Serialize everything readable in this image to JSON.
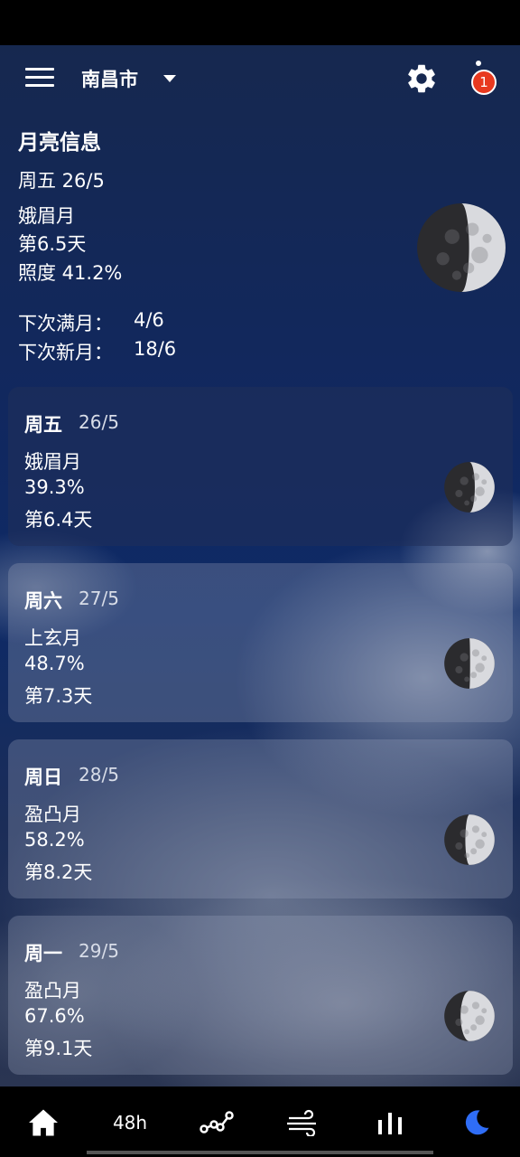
{
  "header": {
    "city": "南昌市",
    "notification_count": "1"
  },
  "moon_info": {
    "title": "月亮信息",
    "date": "周五 26/5",
    "phase": "娥眉月",
    "age": "第6.5天",
    "illumination": "照度  41.2%",
    "next_full_label": "下次满月：",
    "next_full_value": "4/6",
    "next_new_label": "下次新月：",
    "next_new_value": "18/6",
    "moon_illumination_fraction": 0.412
  },
  "days": [
    {
      "day": "周五",
      "date": "26/5",
      "phase": "娥眉月",
      "illumination": "39.3%",
      "age": "第6.4天",
      "illumination_fraction": 0.393
    },
    {
      "day": "周六",
      "date": "27/5",
      "phase": "上玄月",
      "illumination": "48.7%",
      "age": "第7.3天",
      "illumination_fraction": 0.487
    },
    {
      "day": "周日",
      "date": "28/5",
      "phase": "盈凸月",
      "illumination": "58.2%",
      "age": "第8.2天",
      "illumination_fraction": 0.582
    },
    {
      "day": "周一",
      "date": "29/5",
      "phase": "盈凸月",
      "illumination": "67.6%",
      "age": "第9.1天",
      "illumination_fraction": 0.676
    }
  ],
  "bottom_nav": {
    "items": [
      {
        "icon": "home-icon"
      },
      {
        "label": "48h"
      },
      {
        "icon": "graph-icon"
      },
      {
        "icon": "wind-icon"
      },
      {
        "icon": "bar-chart-icon"
      },
      {
        "icon": "moon-icon"
      }
    ],
    "active_color": "#2f6df6"
  }
}
